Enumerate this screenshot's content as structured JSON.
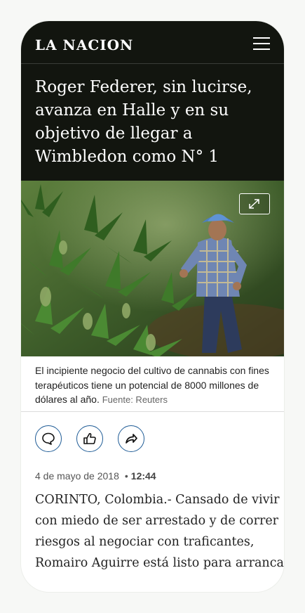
{
  "header": {
    "logo": "LA NACION"
  },
  "article": {
    "headline_lines": [
      "Roger Federer, sin lucirse,",
      "avanza en Halle y en su",
      "objetivo de llegar a",
      "Wimbledon como N° 1"
    ],
    "caption": "El incipiente negocio del cultivo de cannabis con fines terapéuticos tiene un potencial de 8000 millones de dólares al año.",
    "caption_source": "Fuente: Reuters",
    "date": "4 de mayo de 2018",
    "separator": "•",
    "time": "12:44",
    "body_lines": [
      "CORINTO, Colombia.- Cansado de vivir",
      "con miedo de ser arrestado y de correr",
      "riesgos al negociar con traficantes,",
      "Romairo Aguirre está listo para arrancar"
    ]
  },
  "actions": {
    "icons": [
      "comment-icon",
      "like-icon",
      "share-icon"
    ]
  },
  "colors": {
    "header_bg": "#12150f",
    "accent": "#1f5c96"
  }
}
